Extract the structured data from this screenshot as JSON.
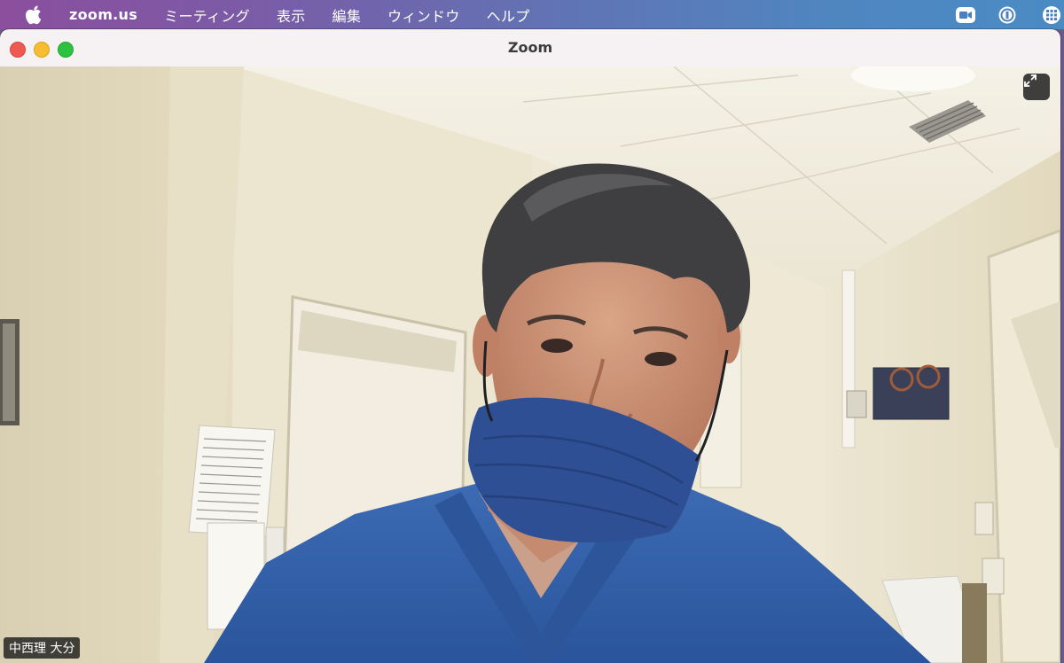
{
  "menubar": {
    "apple_icon": "apple-icon",
    "app_name": "zoom.us",
    "items": [
      {
        "label": "ミーティング"
      },
      {
        "label": "表示"
      },
      {
        "label": "編集"
      },
      {
        "label": "ウィンドウ"
      },
      {
        "label": "ヘルプ"
      }
    ],
    "status_icons": [
      "zoom-camera-icon",
      "keyboard-input-icon",
      "control-grid-icon"
    ]
  },
  "window": {
    "title": "Zoom",
    "controls": [
      "close",
      "minimize",
      "zoom"
    ]
  },
  "video": {
    "participant_name": "中西理 大分",
    "fullscreen_icon": "expand-icon"
  },
  "colors": {
    "close": "#ee5a52",
    "minimize": "#f5bd2f",
    "zoom": "#2cc13f",
    "scrubs": "#2f5ea6",
    "mask": "#2f4f95"
  }
}
